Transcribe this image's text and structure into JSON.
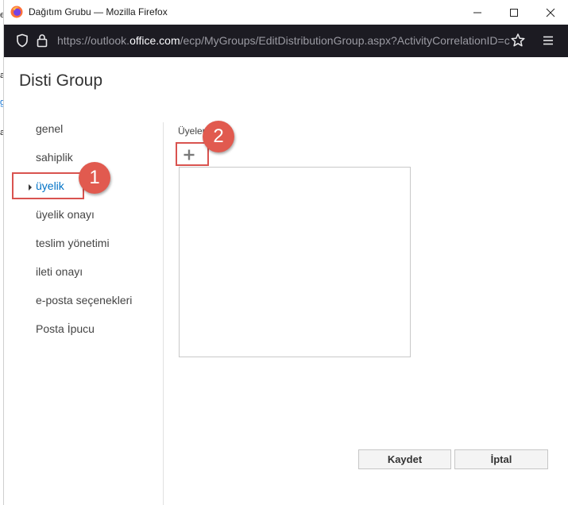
{
  "window": {
    "title": "Dağıtım Grubu — Mozilla Firefox",
    "url_prefix": "https://outlook.",
    "url_domain": "office.com",
    "url_suffix": "/ecp/MyGroups/EditDistributionGroup.aspx?ActivityCorrelationID=c"
  },
  "page": {
    "group_name": "Disti Group"
  },
  "nav": {
    "items": [
      {
        "label": "genel",
        "active": false
      },
      {
        "label": "sahiplik",
        "active": false
      },
      {
        "label": "üyelik",
        "active": true
      },
      {
        "label": "üyelik onayı",
        "active": false
      },
      {
        "label": "teslim yönetimi",
        "active": false
      },
      {
        "label": "ileti onayı",
        "active": false
      },
      {
        "label": "e-posta seçenekleri",
        "active": false
      },
      {
        "label": "Posta İpucu",
        "active": false
      }
    ]
  },
  "members": {
    "label": "Üyeler"
  },
  "buttons": {
    "save": "Kaydet",
    "cancel": "İptal"
  },
  "annotations": {
    "step1": "1",
    "step2": "2",
    "color": "#e15a4f"
  },
  "icons": {
    "app": "firefox-logo-icon",
    "minimize": "minimize-icon",
    "maximize": "maximize-icon",
    "close": "close-icon",
    "tracking": "shield-icon",
    "secure": "lock-icon",
    "bookmark": "star-icon",
    "menu": "hamburger-menu-icon",
    "add": "plus-icon"
  },
  "colors": {
    "active_nav": "#0072c6",
    "urlbar_bg": "#1c1b22",
    "highlight": "#d9534f"
  }
}
